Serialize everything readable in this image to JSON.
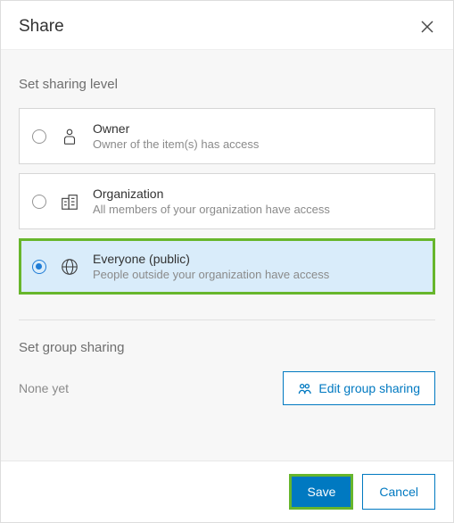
{
  "dialog": {
    "title": "Share"
  },
  "sharing": {
    "section_label": "Set sharing level",
    "options": [
      {
        "title": "Owner",
        "desc": "Owner of the item(s) has access"
      },
      {
        "title": "Organization",
        "desc": "All members of your organization have access"
      },
      {
        "title": "Everyone (public)",
        "desc": "People outside your organization have access"
      }
    ],
    "selected_index": 2
  },
  "group": {
    "section_label": "Set group sharing",
    "none_text": "None yet",
    "edit_label": "Edit group sharing"
  },
  "footer": {
    "save": "Save",
    "cancel": "Cancel"
  }
}
